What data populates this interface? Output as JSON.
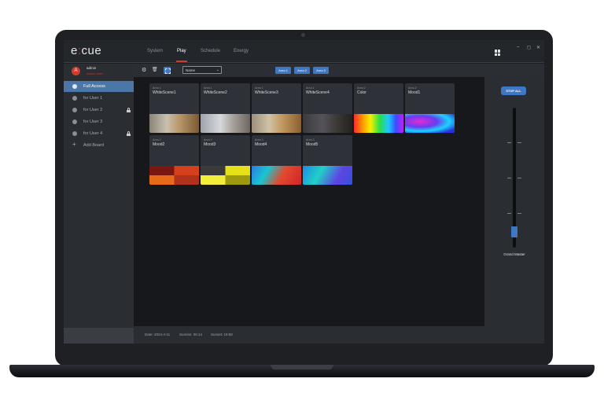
{
  "app": {
    "logo_left": "e",
    "logo_colon": ":",
    "logo_right": "cue"
  },
  "nav": {
    "tabs": [
      {
        "label": "System",
        "active": false
      },
      {
        "label": "Play",
        "active": true
      },
      {
        "label": "Schedule",
        "active": false
      },
      {
        "label": "Energy",
        "active": false
      }
    ]
  },
  "window_controls": {
    "minimize": "–",
    "maximize": "◻",
    "close": "✕"
  },
  "user": {
    "initial": "A",
    "name": "admin",
    "role": "Admin User"
  },
  "sidebar": {
    "items": [
      {
        "label": "Full Access",
        "active": true,
        "locked": false
      },
      {
        "label": "for User 1",
        "active": false,
        "locked": false
      },
      {
        "label": "for User 2",
        "active": false,
        "locked": true
      },
      {
        "label": "for User 3",
        "active": false,
        "locked": false
      },
      {
        "label": "for User 4",
        "active": false,
        "locked": true
      }
    ],
    "add_label": "Add Board",
    "add_icon": "+"
  },
  "toolbar": {
    "settings_icon": "⚙",
    "delete_icon": "🗑",
    "sort_value": "Name",
    "sort_chevron": "⌄",
    "areas": [
      "Area 1",
      "Area 2",
      "Area 3"
    ]
  },
  "scenes": [
    {
      "area": "Area 1",
      "name": "WhiteScene1",
      "thumb": "room-warm"
    },
    {
      "area": "Area 1",
      "name": "WhiteScene2",
      "thumb": "room-cool"
    },
    {
      "area": "Area 1",
      "name": "WhiteScene3",
      "thumb": "room-warm2"
    },
    {
      "area": "Area 1",
      "name": "WhiteScene4",
      "thumb": "room-dark"
    },
    {
      "area": "Area 2",
      "name": "Color",
      "thumb": "rainbow"
    },
    {
      "area": "Area 2",
      "name": "Mood1",
      "thumb": "plasma"
    },
    {
      "area": "Area 2",
      "name": "Mood2",
      "thumb": "pixel-red"
    },
    {
      "area": "Area 2",
      "name": "Mood3",
      "thumb": "pixel-yellow"
    },
    {
      "area": "Area 3",
      "name": "Mood4",
      "thumb": "gradient-warm"
    },
    {
      "area": "Area 3",
      "name": "Mood5",
      "thumb": "gradient-cool"
    }
  ],
  "status": {
    "date": "Date: 2024-4-11",
    "sunrise": "Sunrise: 06:14",
    "sunset": "Sunset: 19:58"
  },
  "master": {
    "stop_label": "STOP ALL",
    "fader_label": "Grand Master",
    "level_percent": 8
  },
  "colors": {
    "accent_red": "#d23a2e",
    "accent_blue": "#3e78c4",
    "sidebar_active": "#4a76a8"
  }
}
